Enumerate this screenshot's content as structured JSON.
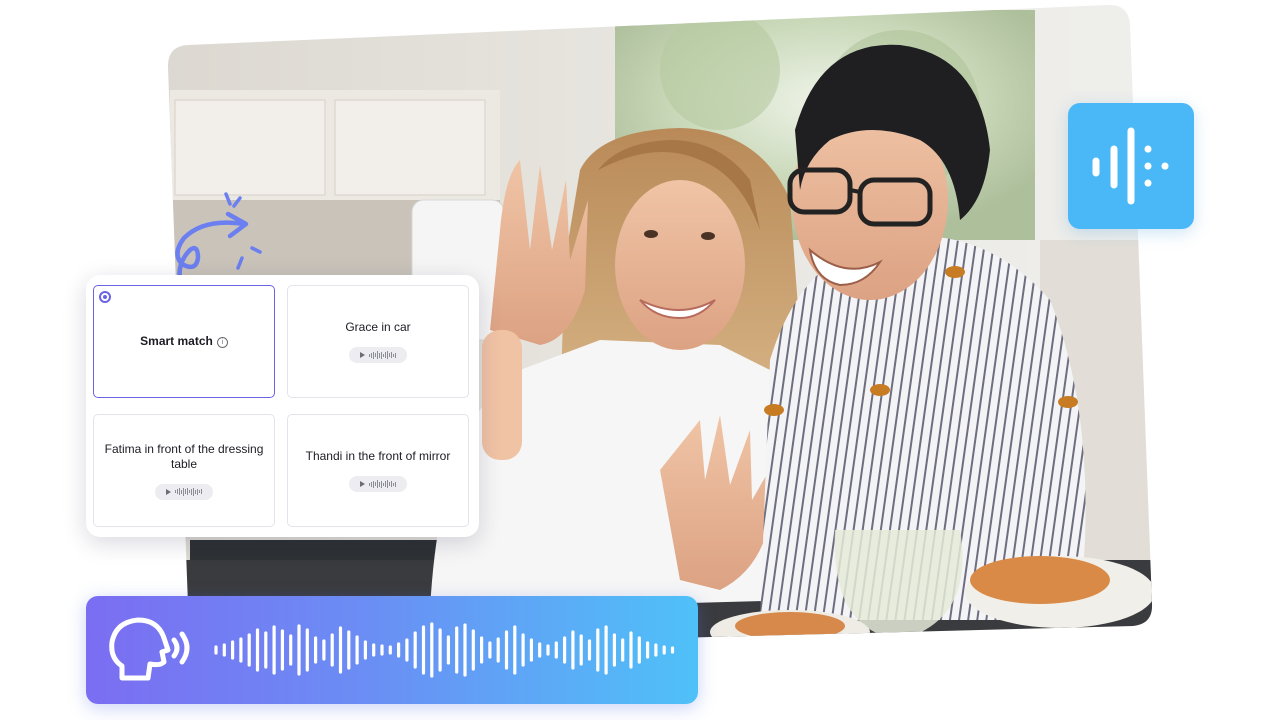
{
  "voice_options": [
    {
      "label": "Smart match",
      "selected": true,
      "icon": "info-icon",
      "has_preview": false
    },
    {
      "label": "Grace in car",
      "selected": false,
      "has_preview": true
    },
    {
      "label": "Fatima in front of the dressing table",
      "selected": false,
      "has_preview": true
    },
    {
      "label": "Thandi in the front of mirror",
      "selected": false,
      "has_preview": true
    }
  ],
  "icons": {
    "info": "i",
    "badge": "audio-waveform-icon",
    "speaker": "speaking-head-icon"
  },
  "colors": {
    "accent": "#6b63e6",
    "badge": "#4ab8f7",
    "voice_bar_start": "#7b6df2",
    "voice_bar_end": "#4fc1f8"
  }
}
